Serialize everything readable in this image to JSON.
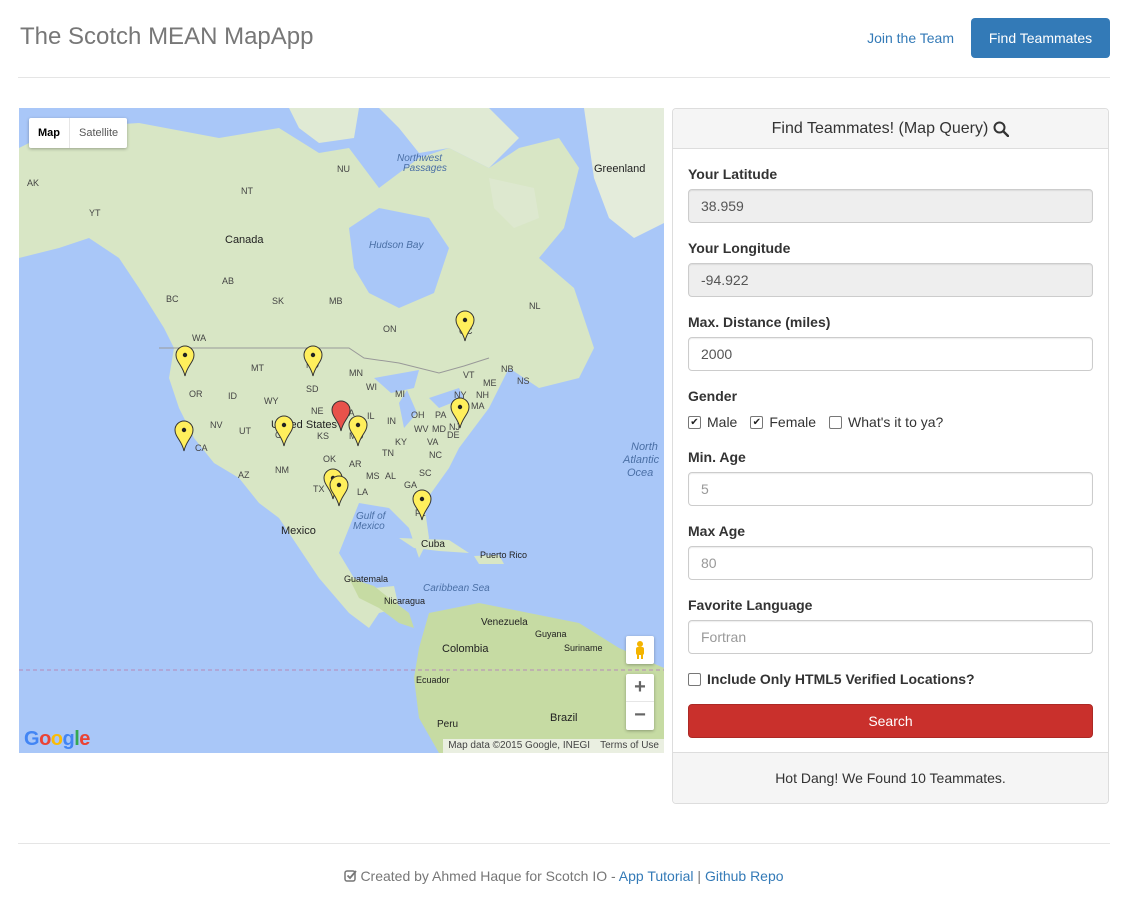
{
  "header": {
    "brand": "The Scotch MEAN MapApp",
    "join_link": "Join the Team",
    "find_button": "Find Teammates"
  },
  "map": {
    "type_controls": {
      "map": "Map",
      "satellite": "Satellite"
    },
    "labels": [
      {
        "id": "greenland",
        "text": "Greenland"
      },
      {
        "id": "nwp",
        "text": "Northwest"
      },
      {
        "id": "nwp2",
        "text": "Passages"
      },
      {
        "id": "canada",
        "text": "Canada"
      },
      {
        "id": "hudson",
        "text": "Hudson Bay"
      },
      {
        "id": "us",
        "text": "United States"
      },
      {
        "id": "mexico",
        "text": "Mexico"
      },
      {
        "id": "gulf",
        "text": "Gulf of"
      },
      {
        "id": "gulf2",
        "text": "Mexico"
      },
      {
        "id": "cuba",
        "text": "Cuba"
      },
      {
        "id": "pr",
        "text": "Puerto Rico"
      },
      {
        "id": "guat",
        "text": "Guatemala"
      },
      {
        "id": "nica",
        "text": "Nicaragua"
      },
      {
        "id": "carib",
        "text": "Caribbean Sea"
      },
      {
        "id": "venez",
        "text": "Venezuela"
      },
      {
        "id": "colom",
        "text": "Colombia"
      },
      {
        "id": "guyana",
        "text": "Guyana"
      },
      {
        "id": "surin",
        "text": "Suriname"
      },
      {
        "id": "ecuador",
        "text": "Ecuador"
      },
      {
        "id": "peru",
        "text": "Peru"
      },
      {
        "id": "brazil",
        "text": "Brazil"
      },
      {
        "id": "natl",
        "text": "North"
      },
      {
        "id": "natl2",
        "text": "Atlantic"
      },
      {
        "id": "natl3",
        "text": "Ocea"
      },
      {
        "id": "ak",
        "text": "AK"
      },
      {
        "id": "yt",
        "text": "YT"
      },
      {
        "id": "nt",
        "text": "NT"
      },
      {
        "id": "nu",
        "text": "NU"
      },
      {
        "id": "bc",
        "text": "BC"
      },
      {
        "id": "ab",
        "text": "AB"
      },
      {
        "id": "sk",
        "text": "SK"
      },
      {
        "id": "mb",
        "text": "MB"
      },
      {
        "id": "on",
        "text": "ON"
      },
      {
        "id": "qc",
        "text": "QC"
      },
      {
        "id": "nl",
        "text": "NL"
      },
      {
        "id": "nb",
        "text": "NB"
      },
      {
        "id": "ns",
        "text": "NS"
      },
      {
        "id": "wa",
        "text": "WA"
      },
      {
        "id": "mt",
        "text": "MT"
      },
      {
        "id": "nd",
        "text": "ND"
      },
      {
        "id": "mn",
        "text": "MN"
      },
      {
        "id": "or",
        "text": "OR"
      },
      {
        "id": "id",
        "text": "ID"
      },
      {
        "id": "sd",
        "text": "SD"
      },
      {
        "id": "wy",
        "text": "WY"
      },
      {
        "id": "wi",
        "text": "WI"
      },
      {
        "id": "mi",
        "text": "MI"
      },
      {
        "id": "ia",
        "text": "IA"
      },
      {
        "id": "ne",
        "text": "NE"
      },
      {
        "id": "nv",
        "text": "NV"
      },
      {
        "id": "ut",
        "text": "UT"
      },
      {
        "id": "co",
        "text": "CO"
      },
      {
        "id": "ks",
        "text": "KS"
      },
      {
        "id": "mo",
        "text": "MO"
      },
      {
        "id": "il",
        "text": "IL"
      },
      {
        "id": "in",
        "text": "IN"
      },
      {
        "id": "oh",
        "text": "OH"
      },
      {
        "id": "pa",
        "text": "PA"
      },
      {
        "id": "ny",
        "text": "NY"
      },
      {
        "id": "me",
        "text": "ME"
      },
      {
        "id": "vt",
        "text": "VT"
      },
      {
        "id": "nh",
        "text": "NH"
      },
      {
        "id": "ma",
        "text": "MA"
      },
      {
        "id": "nj",
        "text": "NJ"
      },
      {
        "id": "md",
        "text": "MD"
      },
      {
        "id": "de",
        "text": "DE"
      },
      {
        "id": "wv",
        "text": "WV"
      },
      {
        "id": "va",
        "text": "VA"
      },
      {
        "id": "ky",
        "text": "KY"
      },
      {
        "id": "tn",
        "text": "TN"
      },
      {
        "id": "nc",
        "text": "NC"
      },
      {
        "id": "sc",
        "text": "SC"
      },
      {
        "id": "ca",
        "text": "CA"
      },
      {
        "id": "az",
        "text": "AZ"
      },
      {
        "id": "nm",
        "text": "NM"
      },
      {
        "id": "ok",
        "text": "OK"
      },
      {
        "id": "ar",
        "text": "AR"
      },
      {
        "id": "tx",
        "text": "TX"
      },
      {
        "id": "la",
        "text": "LA"
      },
      {
        "id": "ms",
        "text": "MS"
      },
      {
        "id": "al",
        "text": "AL"
      },
      {
        "id": "ga",
        "text": "GA"
      },
      {
        "id": "fl",
        "text": "FL"
      }
    ],
    "markers_found": 10,
    "attribution": "Map data ©2015 Google, INEGI",
    "terms": "Terms of Use",
    "logo": "Google"
  },
  "form": {
    "title": "Find Teammates! (Map Query)",
    "latitude_label": "Your Latitude",
    "latitude_value": "38.959",
    "longitude_label": "Your Longitude",
    "longitude_value": "-94.922",
    "distance_label": "Max. Distance (miles)",
    "distance_value": "2000",
    "gender_label": "Gender",
    "gender_male": "Male",
    "gender_female": "Female",
    "gender_other": "What's it to ya?",
    "min_age_label": "Min. Age",
    "min_age_placeholder": "5",
    "max_age_label": "Max Age",
    "max_age_placeholder": "80",
    "language_label": "Favorite Language",
    "language_placeholder": "Fortran",
    "html5_label": "Include Only HTML5 Verified Locations?",
    "search_button": "Search",
    "result_text": "Hot Dang! We Found 10 Teammates."
  },
  "footer": {
    "created_by": "Created by Ahmed Haque for Scotch IO - ",
    "tutorial_link": "App Tutorial",
    "separator": " | ",
    "repo_link": "Github Repo"
  },
  "colors": {
    "primary": "#337ab7",
    "danger": "#c9302c",
    "water": "#a9c7f8",
    "land": "#d8e6c5",
    "marker_yellow": "#ffef5c",
    "marker_red": "#e8524b"
  }
}
